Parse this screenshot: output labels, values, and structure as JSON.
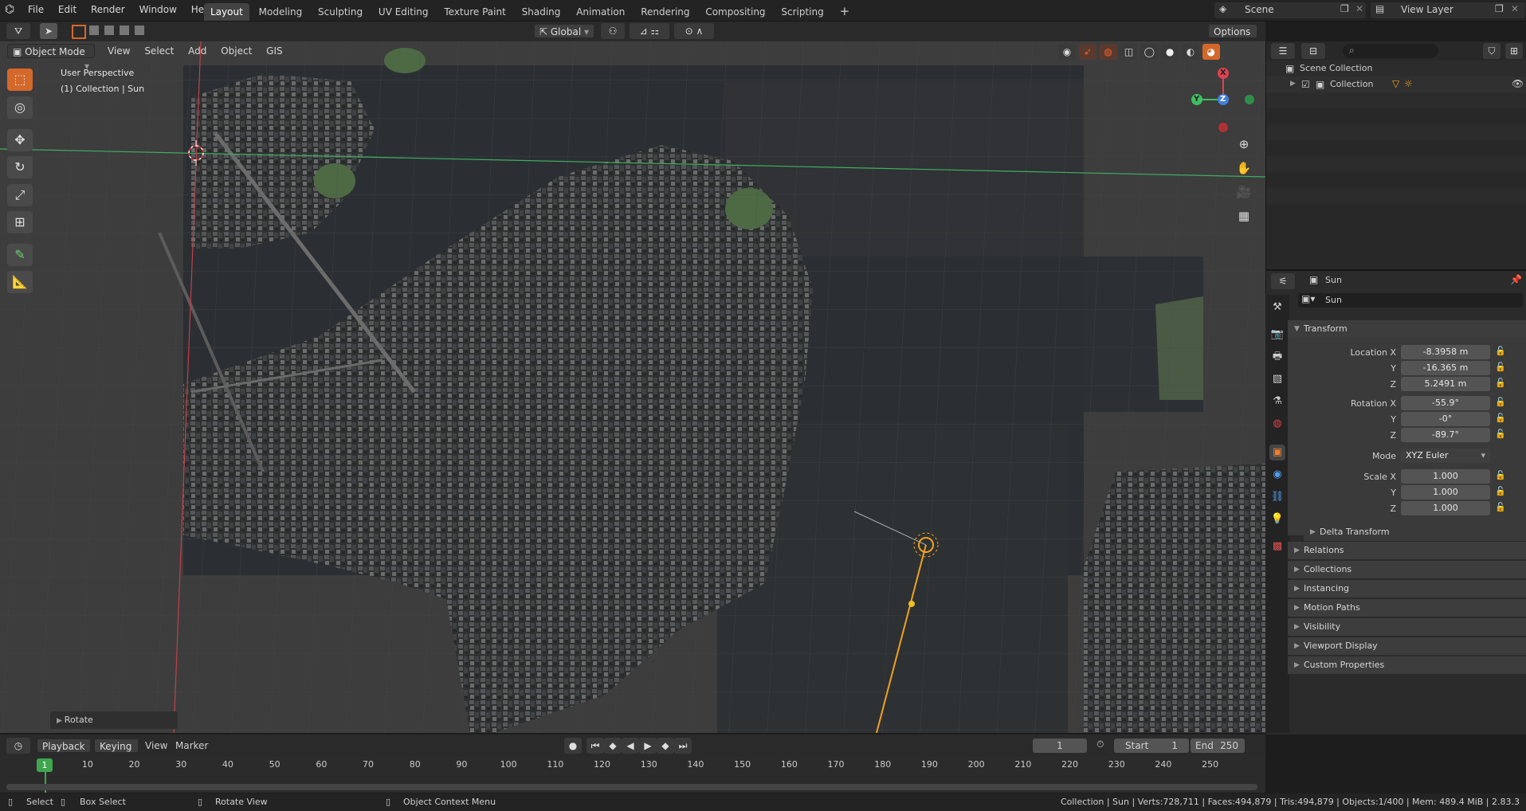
{
  "topbar": {
    "menus": [
      "File",
      "Edit",
      "Render",
      "Window",
      "Help"
    ],
    "workspaces": [
      "Layout",
      "Modeling",
      "Sculpting",
      "UV Editing",
      "Texture Paint",
      "Shading",
      "Animation",
      "Rendering",
      "Compositing",
      "Scripting"
    ],
    "active_workspace": "Layout",
    "add_tab": "+",
    "scene": "Scene",
    "view_layer": "View Layer"
  },
  "viewport": {
    "mode": "Object Mode",
    "menus": [
      "View",
      "Select",
      "Add",
      "Object",
      "GIS"
    ],
    "transform_orientation": "Global",
    "options": "Options",
    "info_line1": "User Perspective",
    "info_line2": "(1) Collection | Sun",
    "last_operator": "Rotate",
    "gizmo": {
      "x": "X",
      "y": "Y",
      "z": "Z"
    }
  },
  "outliner": {
    "search_placeholder": "",
    "scene_collection": "Scene Collection",
    "collection": "Collection"
  },
  "properties": {
    "header_object": "Sun",
    "object_name": "Sun",
    "transform_title": "Transform",
    "location_label": "Location X",
    "location": {
      "x": "-8.3958 m",
      "y": "-16.365 m",
      "z": "5.2491 m"
    },
    "rotation_label": "Rotation X",
    "rotation": {
      "x": "-55.9°",
      "y": "-0°",
      "z": "-89.7°"
    },
    "mode_label": "Mode",
    "mode": "XYZ Euler",
    "scale_label": "Scale X",
    "scale": {
      "x": "1.000",
      "y": "1.000",
      "z": "1.000"
    },
    "axis_y": "Y",
    "axis_z": "Z",
    "delta": "Delta Transform",
    "panels": [
      "Relations",
      "Collections",
      "Instancing",
      "Motion Paths",
      "Visibility",
      "Viewport Display",
      "Custom Properties"
    ]
  },
  "timeline": {
    "menus": [
      "Playback",
      "Keying",
      "View",
      "Marker"
    ],
    "current_frame": "1",
    "start_label": "Start",
    "start": "1",
    "end_label": "End",
    "end": "250",
    "ticks": [
      "10",
      "20",
      "30",
      "40",
      "50",
      "60",
      "70",
      "80",
      "90",
      "100",
      "110",
      "120",
      "130",
      "140",
      "150",
      "160",
      "170",
      "180",
      "190",
      "200",
      "210",
      "220",
      "230",
      "240",
      "250"
    ],
    "playhead": "1"
  },
  "statusbar": {
    "select": "Select",
    "box_select": "Box Select",
    "rotate_view": "Rotate View",
    "context_menu": "Object Context Menu",
    "stats": "Collection | Sun | Verts:728,711 | Faces:494,879 | Tris:494,879 | Objects:1/400 | Mem: 489.4 MiB | 2.83.3"
  },
  "colors": {
    "accent": "#d4682a",
    "active_tab": "#434343",
    "x_axis": "#e0414f",
    "y_axis": "#3fbf5f",
    "z_axis": "#3f7fdf",
    "sun": "#f0a020"
  }
}
